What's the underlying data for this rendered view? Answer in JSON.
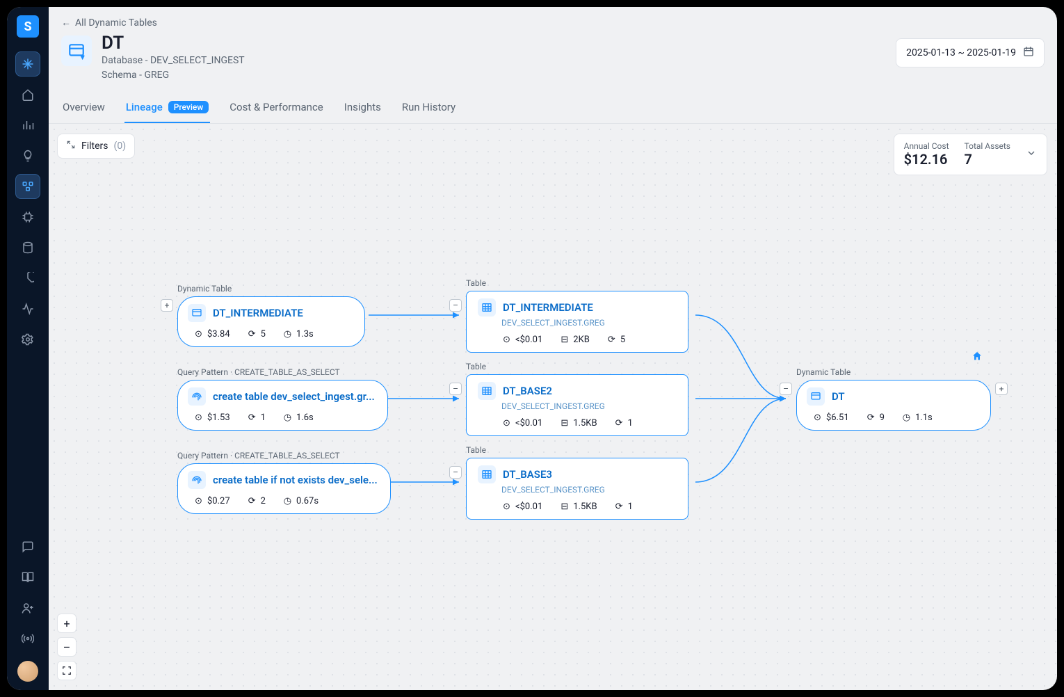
{
  "breadcrumb": "All Dynamic Tables",
  "page": {
    "title": "DT",
    "database_label": "Database - DEV_SELECT_INGEST",
    "schema_label": "Schema - GREG"
  },
  "daterange": "2025-01-13 ~ 2025-01-19",
  "tabs": {
    "overview": "Overview",
    "lineage": "Lineage",
    "lineage_badge": "Preview",
    "cost": "Cost & Performance",
    "insights": "Insights",
    "history": "Run History"
  },
  "filters": {
    "label": "Filters",
    "count": "(0)"
  },
  "summary": {
    "annual_cost_label": "Annual Cost",
    "annual_cost_value": "$12.16",
    "total_assets_label": "Total Assets",
    "total_assets_value": "7"
  },
  "nodes": {
    "n1": {
      "type_label": "Dynamic Table",
      "title": "DT_INTERMEDIATE",
      "cost": "$3.84",
      "refresh": "5",
      "time": "1.3s"
    },
    "n2": {
      "type_label": "Query Pattern · CREATE_TABLE_AS_SELECT",
      "title": "create table dev_select_ingest.gr...",
      "cost": "$1.53",
      "refresh": "1",
      "time": "1.6s"
    },
    "n3": {
      "type_label": "Query Pattern · CREATE_TABLE_AS_SELECT",
      "title": "create table if not exists dev_sele...",
      "cost": "$0.27",
      "refresh": "2",
      "time": "0.67s"
    },
    "n4": {
      "type_label": "Table",
      "title": "DT_INTERMEDIATE",
      "sub": "DEV_SELECT_INGEST.GREG",
      "cost": "<$0.01",
      "size": "2KB",
      "refresh": "5"
    },
    "n5": {
      "type_label": "Table",
      "title": "DT_BASE2",
      "sub": "DEV_SELECT_INGEST.GREG",
      "cost": "<$0.01",
      "size": "1.5KB",
      "refresh": "1"
    },
    "n6": {
      "type_label": "Table",
      "title": "DT_BASE3",
      "sub": "DEV_SELECT_INGEST.GREG",
      "cost": "<$0.01",
      "size": "1.5KB",
      "refresh": "1"
    },
    "n7": {
      "type_label": "Dynamic Table",
      "title": "DT",
      "cost": "$6.51",
      "refresh": "9",
      "time": "1.1s"
    }
  },
  "zoom": {
    "in": "+",
    "out": "–"
  }
}
